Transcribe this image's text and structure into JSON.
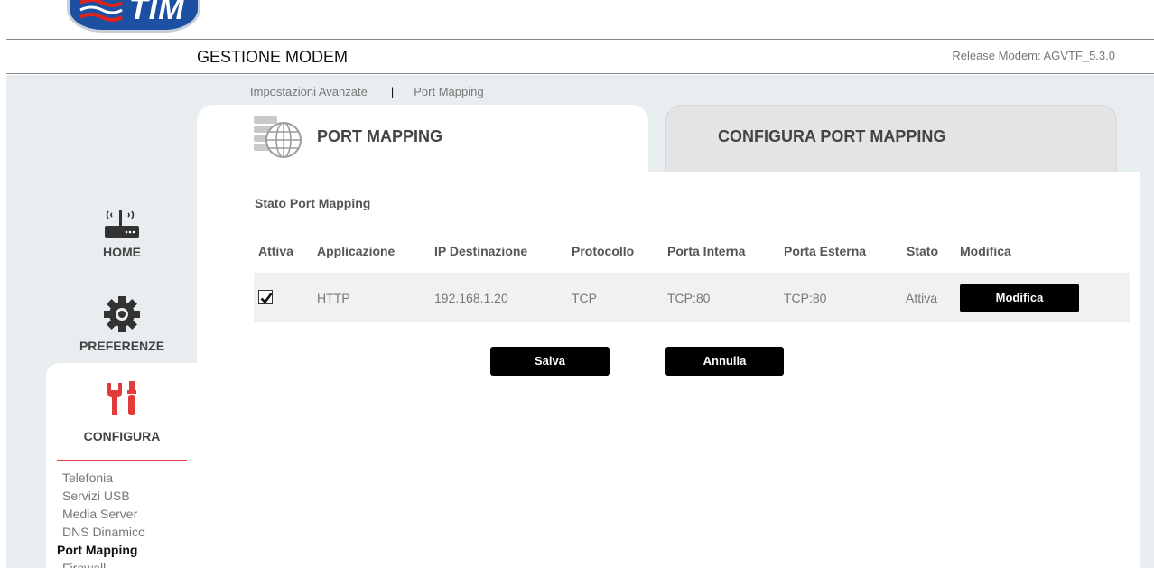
{
  "brand": {
    "logo_text": "TIM",
    "logo_color": "#1d4fa3"
  },
  "header": {
    "title": "GESTIONE MODEM",
    "release": "Release Modem: AGVTF_5.3.0"
  },
  "breadcrumb": {
    "items": [
      "Impostazioni Avanzate",
      "Port Mapping"
    ],
    "separator": "|"
  },
  "tabs": [
    {
      "label": "PORT MAPPING",
      "active": true,
      "icon": "server-globe-icon"
    },
    {
      "label": "CONFIGURA PORT MAPPING",
      "active": false
    }
  ],
  "section": {
    "title": "Stato Port Mapping"
  },
  "table": {
    "headers": [
      "Attiva",
      "Applicazione",
      "IP Destinazione",
      "Protocollo",
      "Porta Interna",
      "Porta Esterna",
      "Stato",
      "Modifica"
    ],
    "rows": [
      {
        "attiva": true,
        "applicazione": "HTTP",
        "ip": "192.168.1.20",
        "protocollo": "TCP",
        "porta_interna": "TCP:80",
        "porta_esterna": "TCP:80",
        "stato": "Attiva",
        "modifica_label": "Modifica"
      }
    ]
  },
  "actions": {
    "save_label": "Salva",
    "cancel_label": "Annulla"
  },
  "sidebar": {
    "items": [
      {
        "label": "HOME",
        "icon": "router-icon"
      },
      {
        "label": "PREFERENZE",
        "icon": "gear-icon"
      },
      {
        "label": "CONFIGURA",
        "icon": "tools-icon",
        "active": true
      }
    ],
    "submenu": [
      "Telefonia",
      "Servizi USB",
      "Media Server",
      "DNS Dinamico",
      "Port Mapping",
      "Firewall"
    ],
    "submenu_active": "Port Mapping",
    "accent_color": "#e23b3b"
  }
}
